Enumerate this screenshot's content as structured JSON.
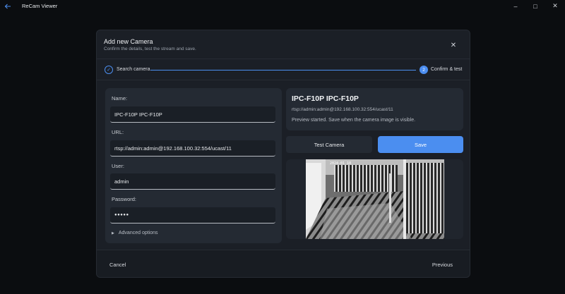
{
  "app": {
    "title": "ReCam Viewer",
    "back_icon": "back-arrow-icon"
  },
  "window_controls": {
    "minimize": "–",
    "maximize": "□",
    "close": "✕"
  },
  "dialog": {
    "title": "Add new Camera",
    "subtitle": "Confirm the details, test the stream and save.",
    "close_icon": "✕"
  },
  "stepper": {
    "steps": [
      {
        "label": "Search camera",
        "state": "done",
        "marker": "✓"
      },
      {
        "label": "Confirm & test",
        "state": "active",
        "marker": "2"
      }
    ]
  },
  "form": {
    "name_label": "Name:",
    "name_value": "IPC-F10P IPC-F10P",
    "url_label": "URL:",
    "url_value": "rtsp://admin:admin@192.168.100.32:554/ucast/11",
    "user_label": "User:",
    "user_value": "admin",
    "password_label": "Password:",
    "password_value": "●●●●●",
    "advanced_label": "Advanced options"
  },
  "camera_info": {
    "name": "IPC-F10P IPC-F10P",
    "url": "rtsp://admin:admin@192.168.100.32:554/ucast/11",
    "status": "Preview started. Save when the camera image is visible."
  },
  "actions": {
    "test_label": "Test Camera",
    "save_label": "Save",
    "cancel_label": "Cancel",
    "previous_label": "Previous"
  },
  "preview": {
    "timestamp": "2024-01 10"
  },
  "colors": {
    "accent": "#4b8ef0",
    "background": "#0b0d10",
    "dialog": "#1b1f26",
    "card": "#242a33"
  }
}
